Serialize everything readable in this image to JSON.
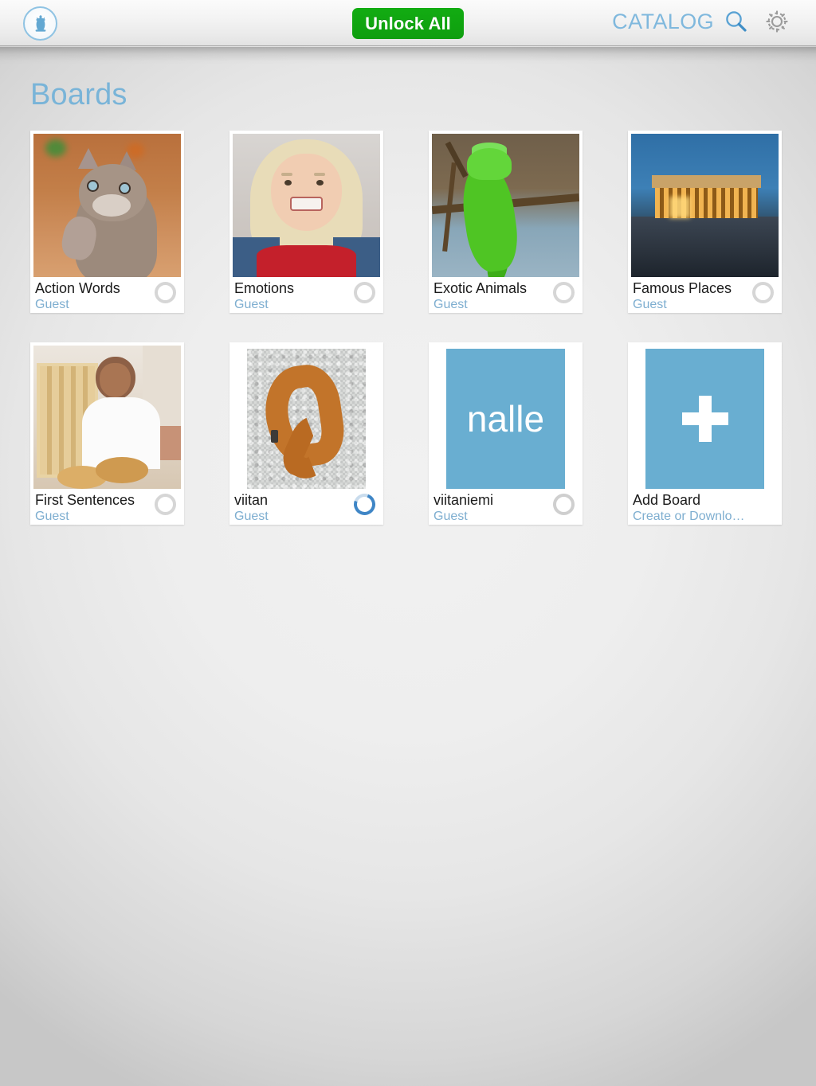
{
  "navbar": {
    "profile_icon": "person-chess-piece-icon",
    "unlock_label": "Unlock All",
    "catalog_label": "CATALOG",
    "search_icon": "search-icon",
    "settings_icon": "gear-icon"
  },
  "page": {
    "title": "Boards"
  },
  "colors": {
    "accent_blue": "#7fb8dd",
    "tile_blue": "#69aed1",
    "unlock_green": "#11a711",
    "loading_blue": "#3f86c6",
    "title_text": "#1b1b1b",
    "sub_text": "#7eaed0"
  },
  "boards": [
    {
      "title": "Action Words",
      "subtitle": "Guest",
      "thumb": "cat-photo",
      "status": "idle",
      "inset": false
    },
    {
      "title": "Emotions",
      "subtitle": "Guest",
      "thumb": "girl-photo",
      "status": "idle",
      "inset": false
    },
    {
      "title": "Exotic Animals",
      "subtitle": "Guest",
      "thumb": "lizard-photo",
      "status": "idle",
      "inset": false
    },
    {
      "title": "Famous Places",
      "subtitle": "Guest",
      "thumb": "parthenon-photo",
      "status": "idle",
      "inset": false
    },
    {
      "title": "First Sentences",
      "subtitle": "Guest",
      "thumb": "baker-photo",
      "status": "idle",
      "inset": false
    },
    {
      "title": "viitan",
      "subtitle": "Guest",
      "thumb": "scarf-photo",
      "status": "loading",
      "inset": true
    },
    {
      "title": "viitaniemi",
      "subtitle": "Guest",
      "thumb": "nalle-tile",
      "status": "idle",
      "inset": true,
      "tile_text": "nalle"
    },
    {
      "title": "Add Board",
      "subtitle": "Create or Downlo…",
      "thumb": "plus-tile",
      "status": "none",
      "inset": true
    }
  ]
}
